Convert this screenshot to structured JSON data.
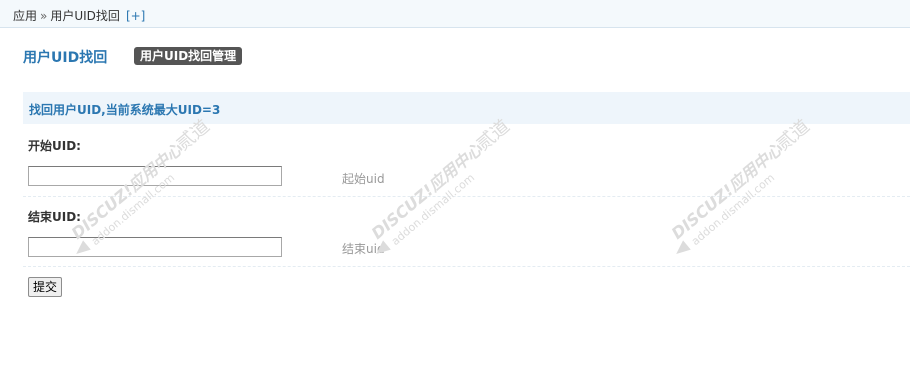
{
  "breadcrumb": {
    "root": "应用",
    "separator": "»",
    "current": "用户UID找回",
    "add": "[+]"
  },
  "page": {
    "title": "用户UID找回",
    "tab_label": "用户UID找回管理"
  },
  "section": {
    "header": "找回用户UID,当前系统最大UID=3"
  },
  "form": {
    "start": {
      "label": "开始UID:",
      "value": "",
      "hint": "起始uid"
    },
    "end": {
      "label": "结束UID:",
      "value": "",
      "hint": "结束uid"
    },
    "submit_label": "提交"
  },
  "watermark": {
    "brand": "DISCUZ!应用中心",
    "domain": "addon.dismall.com",
    "mark": "贰道"
  },
  "colors": {
    "accent": "#2b77b1",
    "header_bg": "#eef5fb",
    "tab_bg": "#555555",
    "hint": "#999999"
  }
}
